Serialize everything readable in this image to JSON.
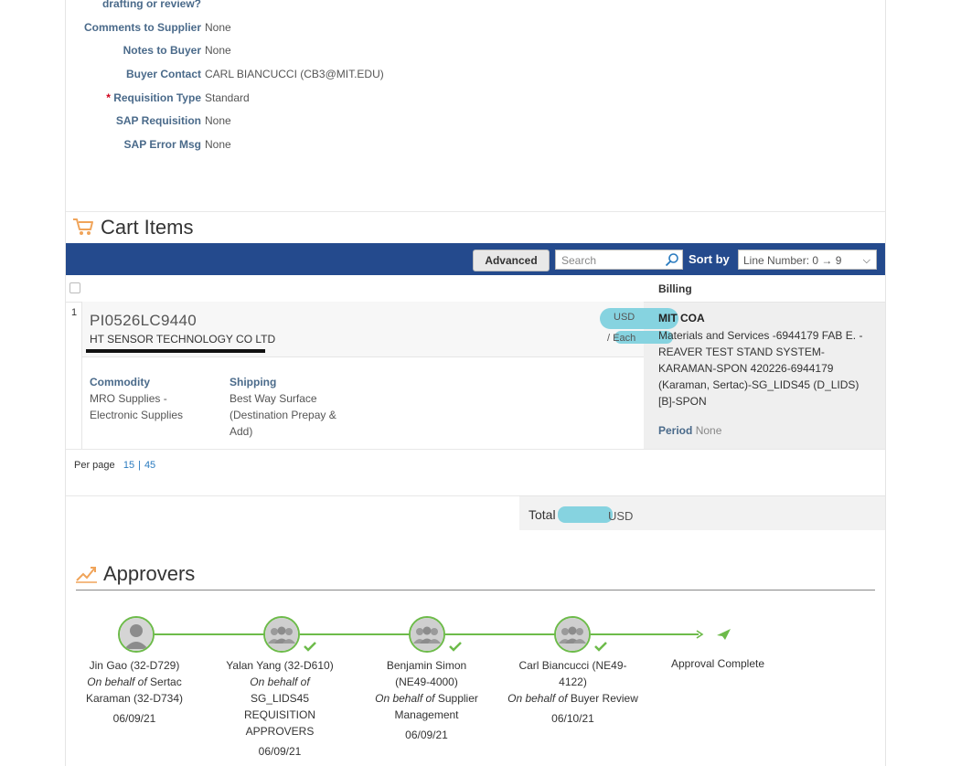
{
  "header_fields": {
    "partial_label": "drafting or review?",
    "rows": [
      {
        "label": "Comments to Supplier",
        "value": "None",
        "required": false
      },
      {
        "label": "Notes to Buyer",
        "value": "None",
        "required": false
      },
      {
        "label": "Buyer Contact",
        "value": "CARL BIANCUCCI (CB3@MIT.EDU)",
        "required": false
      },
      {
        "label": "Requisition Type",
        "value": "Standard",
        "required": true
      },
      {
        "label": "SAP Requisition",
        "value": "None",
        "required": false
      },
      {
        "label": "SAP Error Msg",
        "value": "None",
        "required": false
      }
    ],
    "required_marker": "*"
  },
  "cart": {
    "title": "Cart Items",
    "toolbar": {
      "advanced_label": "Advanced",
      "search_placeholder": "Search",
      "sort_label": "Sort by",
      "sort_value": "Line Number: 0 → 9"
    },
    "billing_header": "Billing",
    "item": {
      "line": "1",
      "id": "PI0526LC9440",
      "supplier": "HT SENSOR TECHNOLOGY CO LTD",
      "currency": "USD",
      "unit": "/ Each",
      "commodity_label": "Commodity",
      "commodity_value": "MRO Supplies - Electronic Supplies",
      "shipping_label": "Shipping",
      "shipping_value": "Best Way Surface (Destination Prepay & Add)",
      "billing_name": "MIT COA",
      "billing_detail": "Materials and Services -6944179 FAB E. - REAVER TEST STAND SYSTEM-KARAMAN-SPON 420226-6944179 (Karaman, Sertac)-SG_LIDS45 (D_LIDS) [B]-SPON",
      "period_label": "Period",
      "period_value": "None"
    },
    "per_page_label": "Per page",
    "per_page_options": [
      "15",
      "45"
    ],
    "total_label": "Total",
    "total_currency": "USD"
  },
  "approvers": {
    "title": "Approvers",
    "steps": [
      {
        "name": "Jin Gao (32-D729)",
        "behalf_prefix": "On behalf of",
        "behalf": "Sertac Karaman (32-D734)",
        "date": "06/09/21"
      },
      {
        "name": "Yalan Yang (32-D610)",
        "behalf_prefix": "On behalf of",
        "behalf": "SG_LIDS45 REQUISITION APPROVERS",
        "date": "06/09/21"
      },
      {
        "name": "Benjamin Simon (NE49-4000)",
        "behalf_prefix": "On behalf of",
        "behalf": "Supplier Management",
        "date": "06/09/21"
      },
      {
        "name": "Carl Biancucci (NE49-4122)",
        "behalf_prefix": "On behalf of",
        "behalf": "Buyer Review",
        "date": "06/10/21"
      }
    ],
    "complete_label": "Approval Complete"
  },
  "colors": {
    "toolbar": "#244a8d",
    "label": "#4a6a8a",
    "approval_green": "#6dbb4a",
    "link": "#2a7bbf",
    "cart_icon": "#f0a45a"
  }
}
